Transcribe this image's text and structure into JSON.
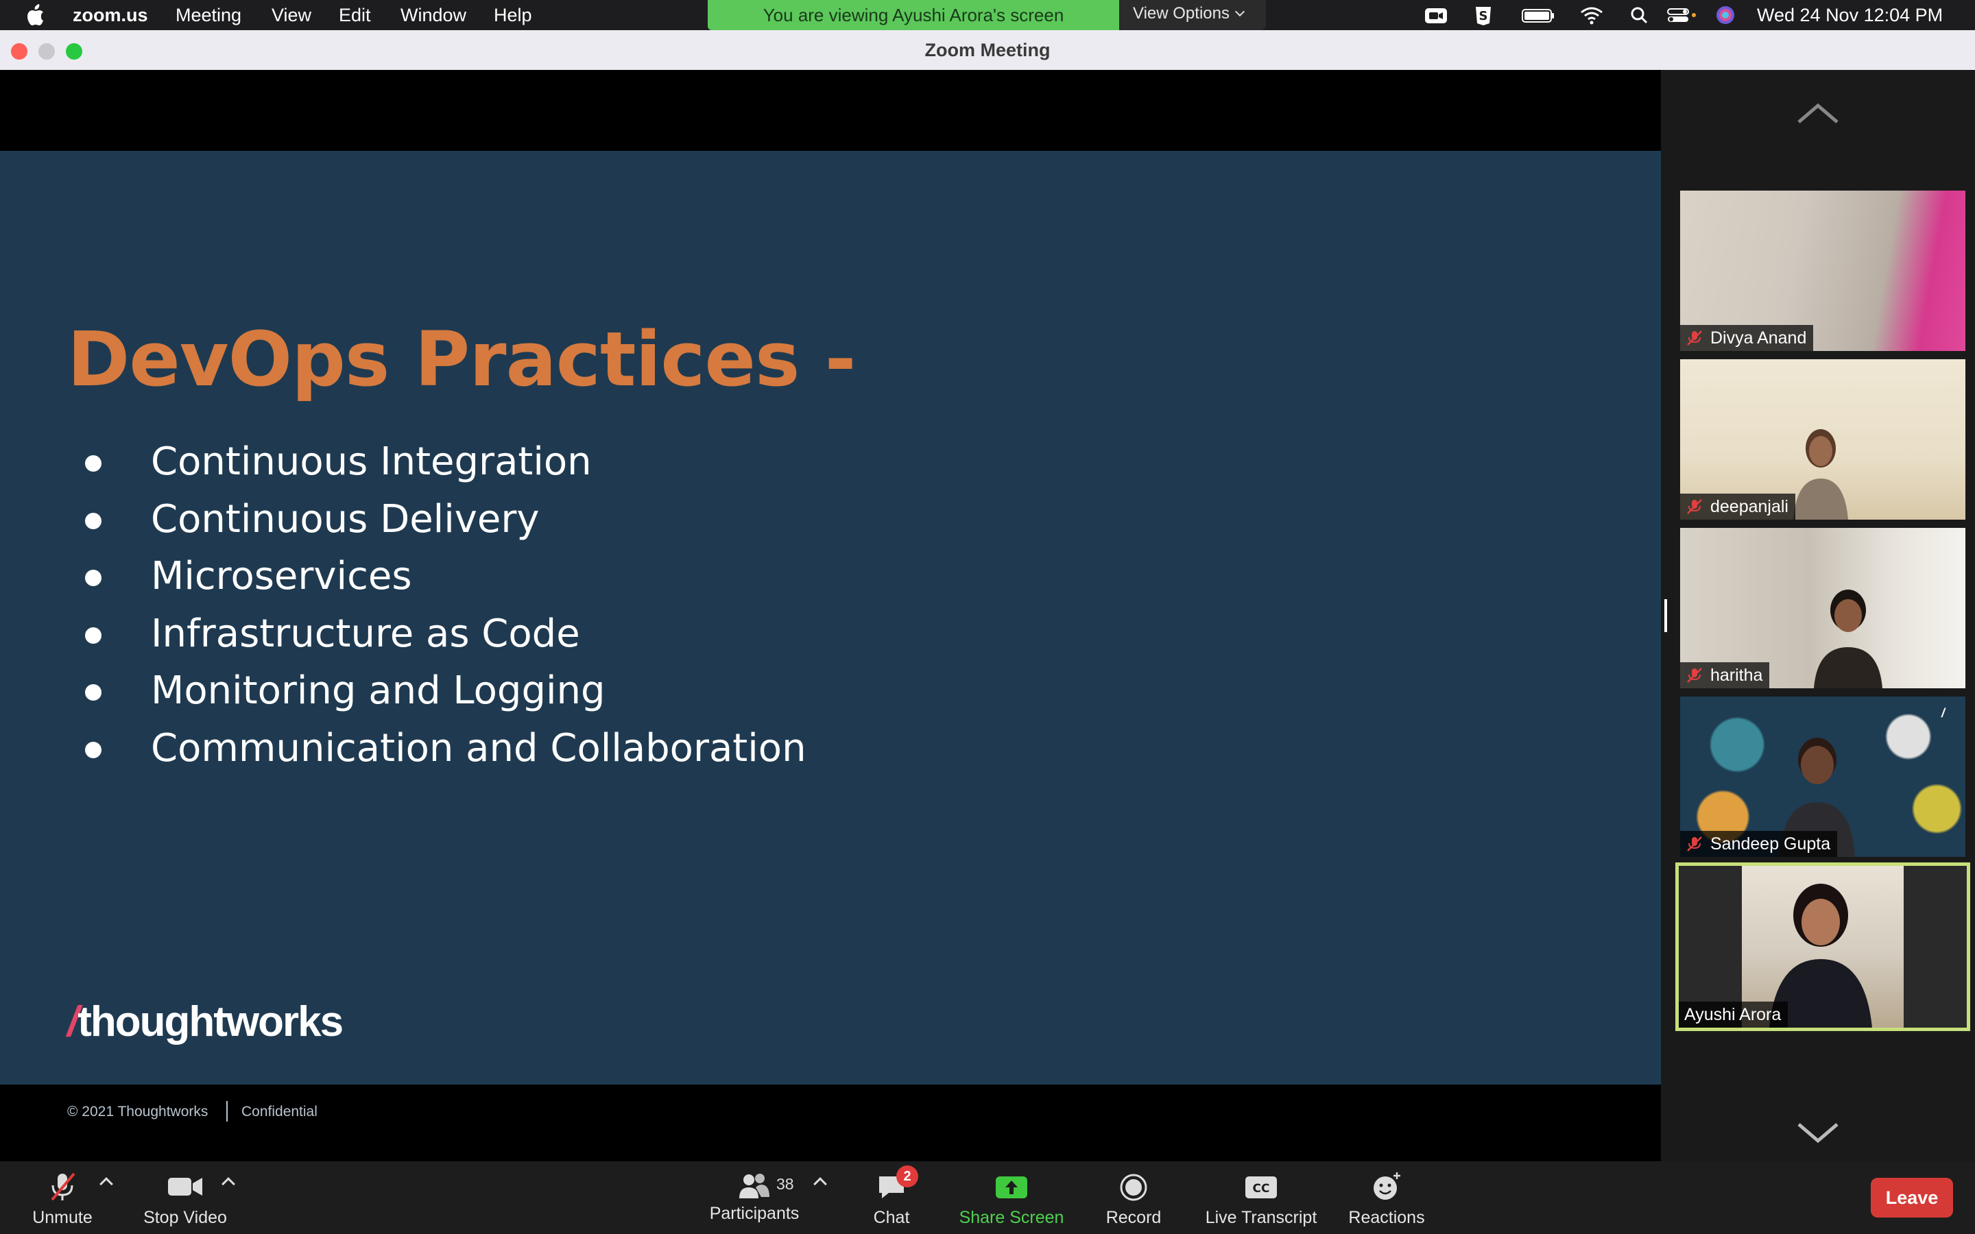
{
  "menubar": {
    "app_name": "zoom.us",
    "items": [
      "Meeting",
      "View",
      "Edit",
      "Window",
      "Help"
    ],
    "banner": "You are viewing Ayushi Arora's screen",
    "view_options": "View Options",
    "clock": "Wed 24 Nov  12:04 PM"
  },
  "window": {
    "title": "Zoom Meeting"
  },
  "slide": {
    "title": "DevOps Practices -",
    "bullets": [
      "Continuous Integration",
      "Continuous Delivery",
      "Microservices",
      "Infrastructure as Code",
      "Monitoring and Logging",
      "Communication and Collaboration"
    ],
    "logo": "thoughtworks",
    "copyright": "© 2021 Thoughtworks",
    "confidential": "Confidential"
  },
  "gallery": {
    "participants": [
      {
        "name": "Divya Anand",
        "muted": true
      },
      {
        "name": "deepanjali",
        "muted": true
      },
      {
        "name": "haritha",
        "muted": true
      },
      {
        "name": "Sandeep Gupta",
        "muted": true
      },
      {
        "name": "Ayushi Arora",
        "muted": false,
        "active_speaker": true
      }
    ]
  },
  "toolbar": {
    "unmute": "Unmute",
    "stop_video": "Stop Video",
    "participants": "Participants",
    "participant_count": "38",
    "chat": "Chat",
    "chat_badge": "2",
    "share_screen": "Share Screen",
    "record": "Record",
    "live_transcript": "Live Transcript",
    "reactions": "Reactions",
    "leave": "Leave"
  },
  "colors": {
    "slide_bg": "#1f3a50",
    "slide_title": "#d67a3f",
    "share_green": "#5cc85a",
    "leave_red": "#d63a36",
    "active_border": "#c8e07a"
  }
}
